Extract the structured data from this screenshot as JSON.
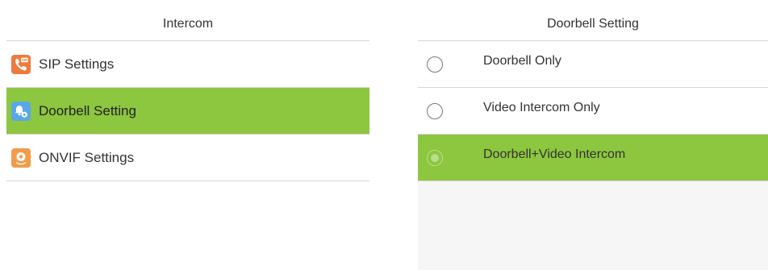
{
  "intercom_panel": {
    "title": "Intercom",
    "items": [
      {
        "label": "SIP Settings",
        "icon": "sip-phone-icon",
        "icon_color": "#f07a3c",
        "active": false
      },
      {
        "label": "Doorbell Setting",
        "icon": "doorbell-gear-icon",
        "icon_color": "#5aa7e8",
        "active": true
      },
      {
        "label": "ONVIF Settings",
        "icon": "onvif-icon",
        "icon_color": "#f29b4a",
        "active": false
      }
    ]
  },
  "doorbell_panel": {
    "title": "Doorbell Setting",
    "options": [
      {
        "label": "Doorbell Only",
        "selected": false
      },
      {
        "label": "Video Intercom Only",
        "selected": false
      },
      {
        "label": "Doorbell+Video Intercom",
        "selected": true
      }
    ]
  },
  "colors": {
    "accent_green": "#8dc63f",
    "divider": "#d6d6d6",
    "right_panel_bg": "#f6f6f6"
  }
}
